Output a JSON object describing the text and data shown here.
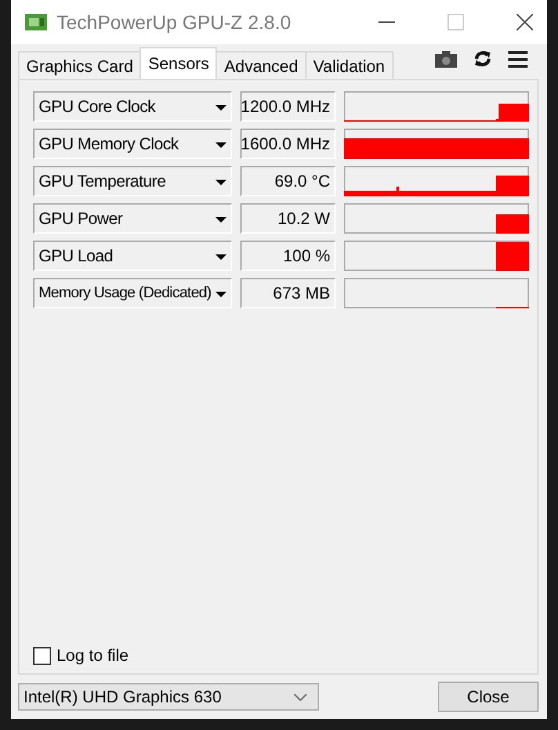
{
  "window": {
    "title": "TechPowerUp GPU-Z 2.8.0"
  },
  "tabs": [
    {
      "label": "Graphics Card",
      "selected": false
    },
    {
      "label": "Sensors",
      "selected": true
    },
    {
      "label": "Advanced",
      "selected": false
    },
    {
      "label": "Validation",
      "selected": false
    }
  ],
  "sensors": [
    {
      "name": "GPU Core Clock",
      "reading": "1200.0 MHz"
    },
    {
      "name": "GPU Memory Clock",
      "reading": "1600.0 MHz"
    },
    {
      "name": "GPU Temperature",
      "reading": "69.0 °C"
    },
    {
      "name": "GPU Power",
      "reading": "10.2 W"
    },
    {
      "name": "GPU Load",
      "reading": "100 %"
    },
    {
      "name": "Memory Usage (Dedicated)",
      "reading": "673 MB"
    }
  ],
  "log_to_file": {
    "label": "Log to file",
    "checked": false
  },
  "device_select": {
    "value": "Intel(R) UHD Graphics 630"
  },
  "buttons": [
    "Close"
  ]
}
